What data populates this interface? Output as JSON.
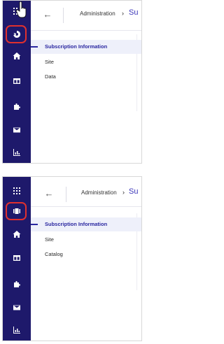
{
  "screens": [
    {
      "breadcrumb": {
        "parent": "Administration",
        "current": "Su"
      },
      "menu": [
        "Subscription Information",
        "Site",
        "Data"
      ],
      "active_index": 0,
      "rail_icons": [
        "menu-icon",
        "highlighted-icon",
        "home-icon",
        "layout-icon",
        "puzzle-icon",
        "mail-icon",
        "chart-icon"
      ]
    },
    {
      "breadcrumb": {
        "parent": "Administration",
        "current": "Su"
      },
      "menu": [
        "Subscription Information",
        "Site",
        "Catalog"
      ],
      "active_index": 0,
      "rail_icons": [
        "grid-icon",
        "highlighted-icon",
        "home-icon",
        "layout-icon",
        "puzzle-icon",
        "mail-icon",
        "chart-icon"
      ]
    }
  ],
  "colors": {
    "rail": "#1e196b",
    "accent": "#2a27a0",
    "highlight": "#e0302e"
  }
}
